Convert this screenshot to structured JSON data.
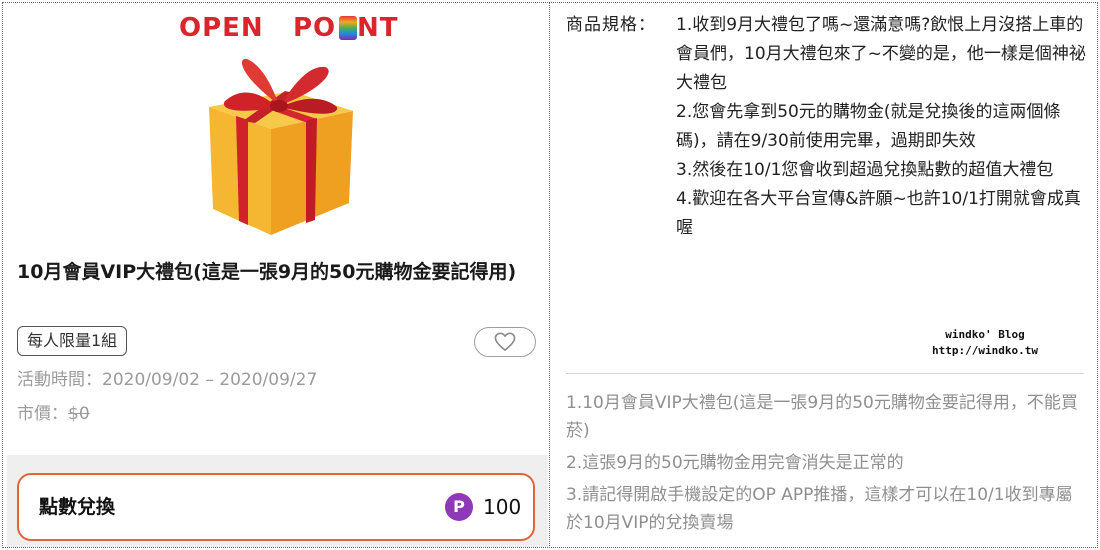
{
  "product": {
    "logo": {
      "word1": "OPEN",
      "word2": "PO",
      "word3": "NT"
    },
    "title": "10月會員VIP大禮包(這是一張9月的50元購物金要記得用)",
    "limit_tag": "每人限量1組",
    "favorite_icon": "heart-icon",
    "period_label": "活動時間：",
    "period_value": "2020/09/02 – 2020/09/27",
    "market_label": "市價：",
    "market_value": "$0",
    "redeem": {
      "label": "點數兌換",
      "point_icon": "P",
      "points": "100"
    }
  },
  "spec": {
    "label": "商品規格：",
    "items": [
      "1.收到9月大禮包了嗎~還滿意嗎?飲恨上月沒搭上車的會員們，10月大禮包來了~不變的是，他一樣是個神祕大禮包",
      "2.您會先拿到50元的購物金(就是兌換後的這兩個條碼)，請在9/30前使用完畢，過期即失效",
      "3.然後在10/1您會收到超過兌換點數的超值大禮包",
      "4.歡迎在各大平台宣傳&許願~也許10/1打開就會成真喔"
    ]
  },
  "watermark": {
    "line1": "windko' Blog",
    "line2": "http://windko.tw"
  },
  "notes": [
    "1.10月會員VIP大禮包(這是一張9月的50元購物金要記得用，不能買菸)",
    "2.這張9月的50元購物金用完會消失是正常的",
    "3.請記得開啟手機設定的OP APP推播，這樣才可以在10/1收到專屬於10月VIP的兌換賣場"
  ],
  "colors": {
    "brand_red": "#d9252b",
    "redeem_border": "#e0663a",
    "point_purple": "#8e3ab8",
    "muted_text": "#9b9b9b"
  }
}
